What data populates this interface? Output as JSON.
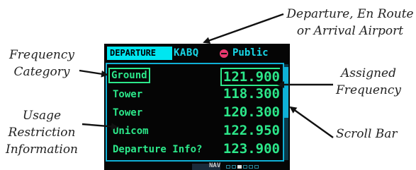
{
  "callouts": {
    "departure_airport": [
      "Departure, En Route",
      "or Arrival Airport"
    ],
    "frequency_category": [
      "Frequency",
      "Category"
    ],
    "usage_restriction": [
      "Usage",
      "Restriction",
      "Information"
    ],
    "assigned_frequency": [
      "Assigned",
      "Frequency"
    ],
    "scroll_bar": [
      "Scroll Bar"
    ]
  },
  "screen": {
    "tab_label": "DEPARTURE",
    "airport_id": "KABQ",
    "status_label": "Public",
    "frequencies": [
      {
        "name": "Ground",
        "value": "121.900"
      },
      {
        "name": "Tower",
        "value": "118.300"
      },
      {
        "name": "Tower",
        "value": "120.300"
      },
      {
        "name": "Unicom",
        "value": "122.950"
      },
      {
        "name": "Departure Info?",
        "value": "123.900"
      }
    ],
    "nav_label": "NAV",
    "colors": {
      "tab_bg": "#00e6f0",
      "text_cyan": "#18d8e8",
      "text_green": "#2ce88a",
      "status_dot": "#e8386e",
      "frame": "#0fb0d6"
    }
  }
}
